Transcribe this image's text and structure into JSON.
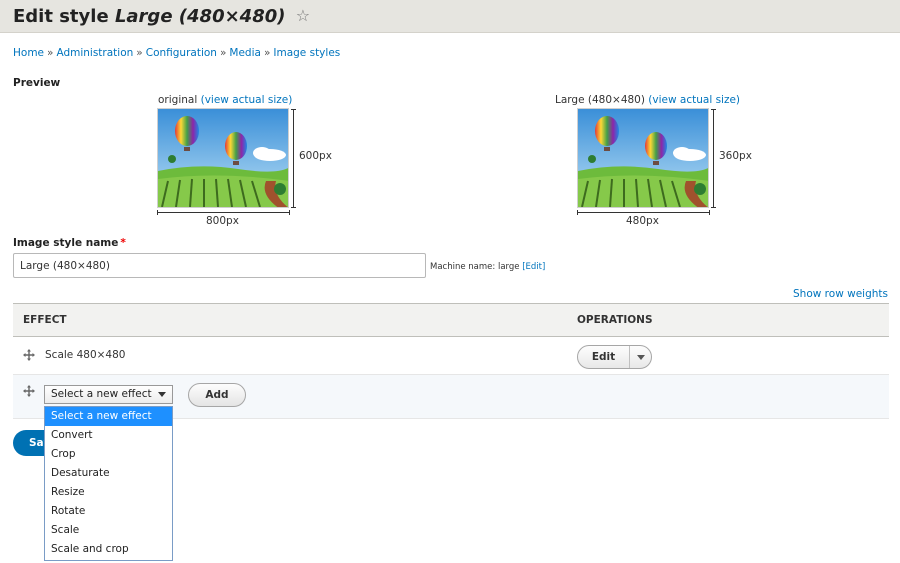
{
  "page": {
    "title_prefix": "Edit style",
    "title_style": "Large (480×480)"
  },
  "breadcrumb": {
    "items": [
      "Home",
      "Administration",
      "Configuration",
      "Media",
      "Image styles"
    ],
    "separator": "»"
  },
  "preview": {
    "label": "Preview",
    "original": {
      "caption": "original",
      "link": "(view actual size)",
      "height_label": "600px",
      "width_label": "800px"
    },
    "derived": {
      "caption": "Large (480×480)",
      "link": "(view actual size)",
      "height_label": "360px",
      "width_label": "480px"
    }
  },
  "form": {
    "name_label": "Image style name",
    "required_marker": "*",
    "name_value": "Large (480×480)",
    "machine_name_prefix": "Machine name: large",
    "machine_name_edit": "[Edit]"
  },
  "table": {
    "show_row_weights": "Show row weights",
    "headers": {
      "effect": "EFFECT",
      "operations": "OPERATIONS"
    },
    "rows": [
      {
        "effect": "Scale 480×480",
        "operation_label": "Edit"
      }
    ],
    "new_effect": {
      "selected": "Select a new effect",
      "add_label": "Add"
    }
  },
  "dropdown": {
    "options": [
      "Select a new effect",
      "Convert",
      "Crop",
      "Desaturate",
      "Resize",
      "Rotate",
      "Scale",
      "Scale and crop"
    ],
    "highlighted_index": 0
  },
  "actions": {
    "save_label": "Save"
  },
  "colors": {
    "link": "#0074bd",
    "header_bg": "#e6e5e0",
    "primary_button": "#0071b3",
    "highlight": "#1e90ff",
    "required": "#e00000"
  }
}
